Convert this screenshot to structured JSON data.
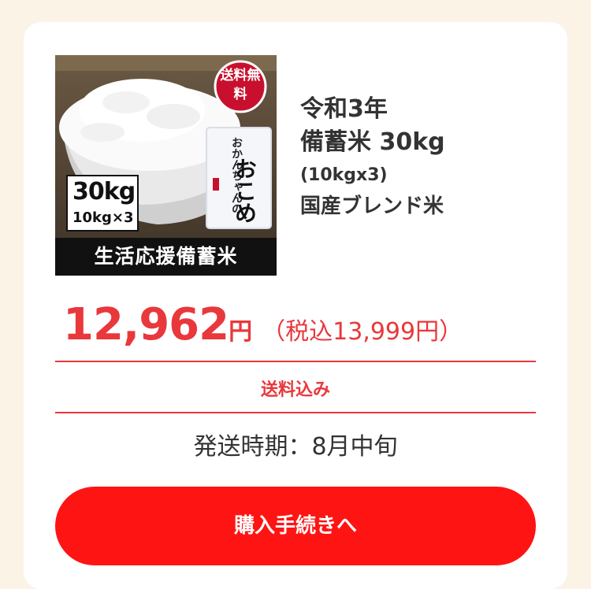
{
  "product": {
    "image": {
      "stamp": "送料無料",
      "bag_small_text": "おかんちゃんの",
      "bag_big_text": "おこめ",
      "weight_main": "30kg",
      "weight_sub": "10kg×3",
      "banner": "生活応援備蓄米"
    },
    "title_line1": "令和3年",
    "title_line2": "備蓄米 30kg",
    "title_line3": "(10kgx3)",
    "title_line4": "国産ブレンド米"
  },
  "price": {
    "amount": "12,962",
    "currency": "円",
    "tax_included": "（税込13,999円）"
  },
  "shipping_included": "送料込み",
  "ship_time": "発送時期：8月中旬",
  "buy_button_label": "購入手続きへ",
  "colors": {
    "accent": "#e8383c",
    "button": "#ff1414",
    "background": "#fbf3e6"
  }
}
